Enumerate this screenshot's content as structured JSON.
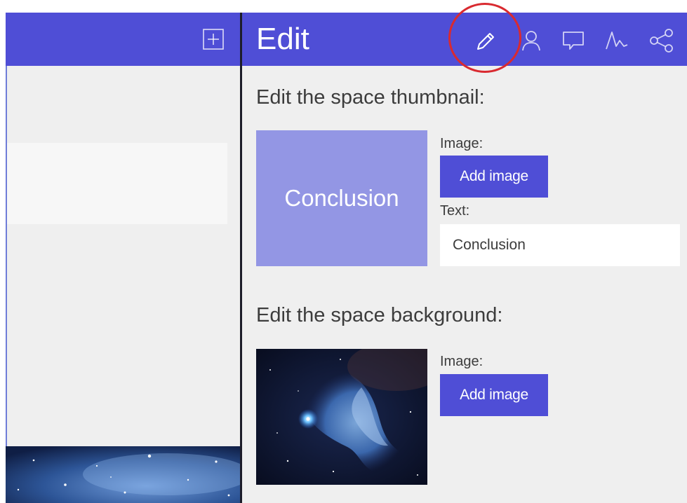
{
  "colors": {
    "accent": "#4f4ed6",
    "thumbnail": "#9396e4",
    "panel": "#efefef",
    "highlight": "#d92a30"
  },
  "left_panel": {
    "header_icon": "add-space-icon"
  },
  "edit_panel": {
    "title": "Edit",
    "toolbar_icons": [
      "pencil-icon",
      "user-icon",
      "comment-icon",
      "activity-icon",
      "share-icon"
    ],
    "active_icon": "pencil-icon"
  },
  "thumbnail_section": {
    "title": "Edit the space thumbnail:",
    "preview_text": "Conclusion",
    "image_label": "Image:",
    "add_image_label": "Add image",
    "text_label": "Text:",
    "text_value": "Conclusion"
  },
  "background_section": {
    "title": "Edit the space background:",
    "image_label": "Image:",
    "add_image_label": "Add image"
  }
}
